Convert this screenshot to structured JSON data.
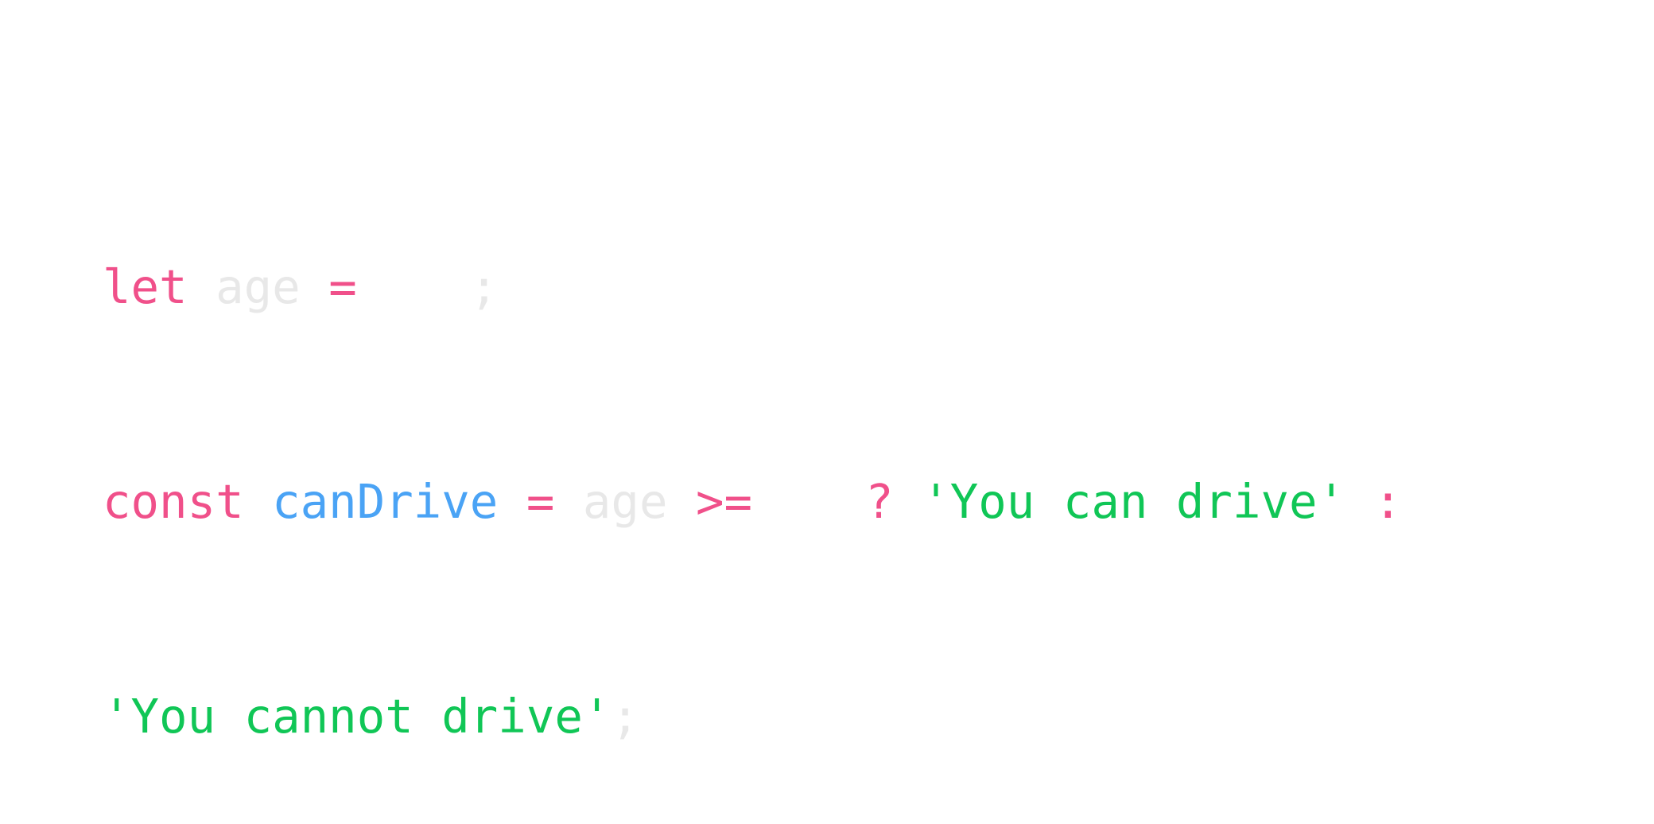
{
  "colors": {
    "keyword": "#f0508a",
    "operator": "#f0508a",
    "identifier": "#4aa3f5",
    "string": "#10c656",
    "faded": "#e8e8e8",
    "background": "#ffffff"
  },
  "code": {
    "line1": {
      "keyword": "let",
      "var": "age",
      "assign": "=",
      "semicolon": ";"
    },
    "line2": {
      "keyword": "const",
      "name": "canDrive",
      "assign": "=",
      "var": "age",
      "compare": ">=",
      "ternary_q": "?",
      "str_true": "'You can drive'",
      "ternary_colon": ":"
    },
    "line3": {
      "str_false": "'You cannot drive'",
      "semicolon": ";"
    }
  }
}
